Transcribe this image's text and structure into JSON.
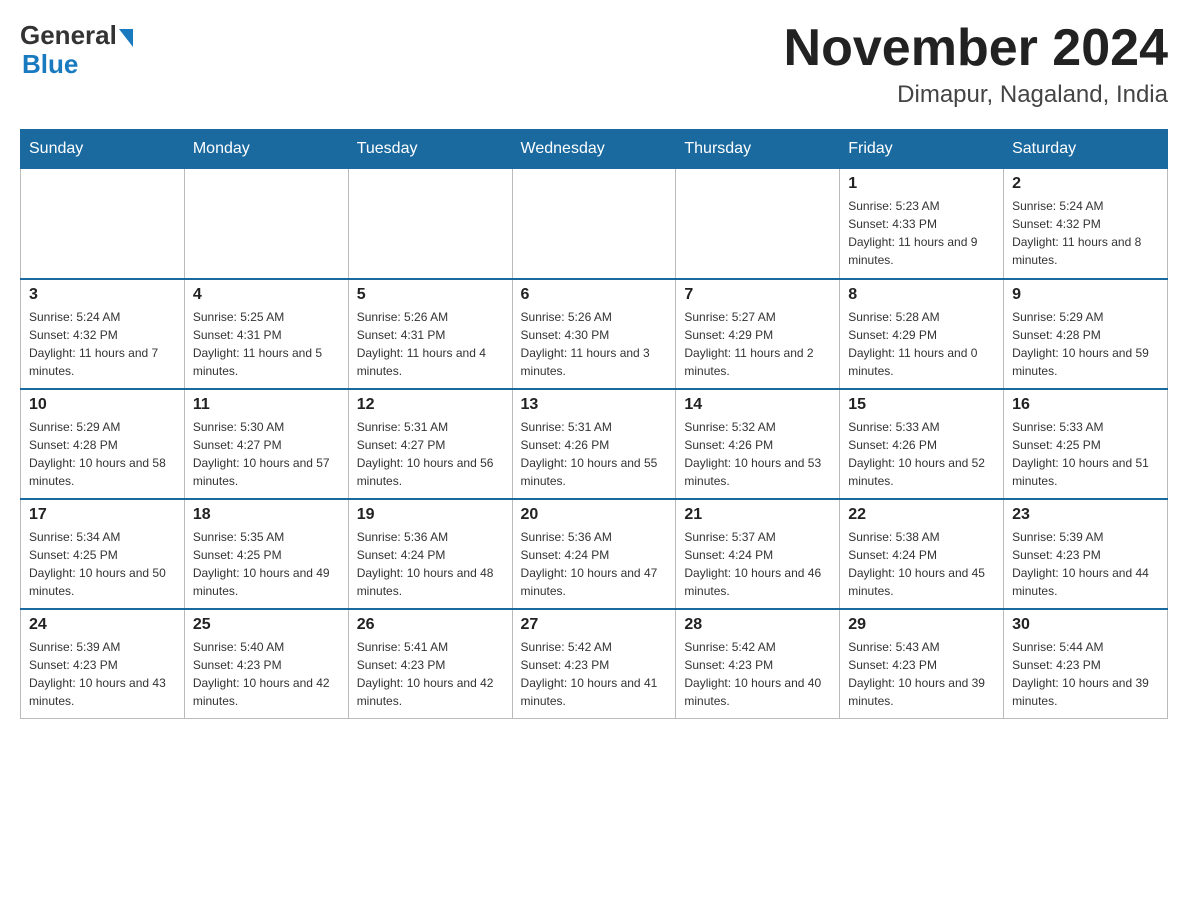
{
  "header": {
    "logo_general": "General",
    "logo_blue": "Blue",
    "month_title": "November 2024",
    "location": "Dimapur, Nagaland, India"
  },
  "days_of_week": [
    "Sunday",
    "Monday",
    "Tuesday",
    "Wednesday",
    "Thursday",
    "Friday",
    "Saturday"
  ],
  "weeks": [
    [
      {
        "day": "",
        "sunrise": "",
        "sunset": "",
        "daylight": ""
      },
      {
        "day": "",
        "sunrise": "",
        "sunset": "",
        "daylight": ""
      },
      {
        "day": "",
        "sunrise": "",
        "sunset": "",
        "daylight": ""
      },
      {
        "day": "",
        "sunrise": "",
        "sunset": "",
        "daylight": ""
      },
      {
        "day": "",
        "sunrise": "",
        "sunset": "",
        "daylight": ""
      },
      {
        "day": "1",
        "sunrise": "Sunrise: 5:23 AM",
        "sunset": "Sunset: 4:33 PM",
        "daylight": "Daylight: 11 hours and 9 minutes."
      },
      {
        "day": "2",
        "sunrise": "Sunrise: 5:24 AM",
        "sunset": "Sunset: 4:32 PM",
        "daylight": "Daylight: 11 hours and 8 minutes."
      }
    ],
    [
      {
        "day": "3",
        "sunrise": "Sunrise: 5:24 AM",
        "sunset": "Sunset: 4:32 PM",
        "daylight": "Daylight: 11 hours and 7 minutes."
      },
      {
        "day": "4",
        "sunrise": "Sunrise: 5:25 AM",
        "sunset": "Sunset: 4:31 PM",
        "daylight": "Daylight: 11 hours and 5 minutes."
      },
      {
        "day": "5",
        "sunrise": "Sunrise: 5:26 AM",
        "sunset": "Sunset: 4:31 PM",
        "daylight": "Daylight: 11 hours and 4 minutes."
      },
      {
        "day": "6",
        "sunrise": "Sunrise: 5:26 AM",
        "sunset": "Sunset: 4:30 PM",
        "daylight": "Daylight: 11 hours and 3 minutes."
      },
      {
        "day": "7",
        "sunrise": "Sunrise: 5:27 AM",
        "sunset": "Sunset: 4:29 PM",
        "daylight": "Daylight: 11 hours and 2 minutes."
      },
      {
        "day": "8",
        "sunrise": "Sunrise: 5:28 AM",
        "sunset": "Sunset: 4:29 PM",
        "daylight": "Daylight: 11 hours and 0 minutes."
      },
      {
        "day": "9",
        "sunrise": "Sunrise: 5:29 AM",
        "sunset": "Sunset: 4:28 PM",
        "daylight": "Daylight: 10 hours and 59 minutes."
      }
    ],
    [
      {
        "day": "10",
        "sunrise": "Sunrise: 5:29 AM",
        "sunset": "Sunset: 4:28 PM",
        "daylight": "Daylight: 10 hours and 58 minutes."
      },
      {
        "day": "11",
        "sunrise": "Sunrise: 5:30 AM",
        "sunset": "Sunset: 4:27 PM",
        "daylight": "Daylight: 10 hours and 57 minutes."
      },
      {
        "day": "12",
        "sunrise": "Sunrise: 5:31 AM",
        "sunset": "Sunset: 4:27 PM",
        "daylight": "Daylight: 10 hours and 56 minutes."
      },
      {
        "day": "13",
        "sunrise": "Sunrise: 5:31 AM",
        "sunset": "Sunset: 4:26 PM",
        "daylight": "Daylight: 10 hours and 55 minutes."
      },
      {
        "day": "14",
        "sunrise": "Sunrise: 5:32 AM",
        "sunset": "Sunset: 4:26 PM",
        "daylight": "Daylight: 10 hours and 53 minutes."
      },
      {
        "day": "15",
        "sunrise": "Sunrise: 5:33 AM",
        "sunset": "Sunset: 4:26 PM",
        "daylight": "Daylight: 10 hours and 52 minutes."
      },
      {
        "day": "16",
        "sunrise": "Sunrise: 5:33 AM",
        "sunset": "Sunset: 4:25 PM",
        "daylight": "Daylight: 10 hours and 51 minutes."
      }
    ],
    [
      {
        "day": "17",
        "sunrise": "Sunrise: 5:34 AM",
        "sunset": "Sunset: 4:25 PM",
        "daylight": "Daylight: 10 hours and 50 minutes."
      },
      {
        "day": "18",
        "sunrise": "Sunrise: 5:35 AM",
        "sunset": "Sunset: 4:25 PM",
        "daylight": "Daylight: 10 hours and 49 minutes."
      },
      {
        "day": "19",
        "sunrise": "Sunrise: 5:36 AM",
        "sunset": "Sunset: 4:24 PM",
        "daylight": "Daylight: 10 hours and 48 minutes."
      },
      {
        "day": "20",
        "sunrise": "Sunrise: 5:36 AM",
        "sunset": "Sunset: 4:24 PM",
        "daylight": "Daylight: 10 hours and 47 minutes."
      },
      {
        "day": "21",
        "sunrise": "Sunrise: 5:37 AM",
        "sunset": "Sunset: 4:24 PM",
        "daylight": "Daylight: 10 hours and 46 minutes."
      },
      {
        "day": "22",
        "sunrise": "Sunrise: 5:38 AM",
        "sunset": "Sunset: 4:24 PM",
        "daylight": "Daylight: 10 hours and 45 minutes."
      },
      {
        "day": "23",
        "sunrise": "Sunrise: 5:39 AM",
        "sunset": "Sunset: 4:23 PM",
        "daylight": "Daylight: 10 hours and 44 minutes."
      }
    ],
    [
      {
        "day": "24",
        "sunrise": "Sunrise: 5:39 AM",
        "sunset": "Sunset: 4:23 PM",
        "daylight": "Daylight: 10 hours and 43 minutes."
      },
      {
        "day": "25",
        "sunrise": "Sunrise: 5:40 AM",
        "sunset": "Sunset: 4:23 PM",
        "daylight": "Daylight: 10 hours and 42 minutes."
      },
      {
        "day": "26",
        "sunrise": "Sunrise: 5:41 AM",
        "sunset": "Sunset: 4:23 PM",
        "daylight": "Daylight: 10 hours and 42 minutes."
      },
      {
        "day": "27",
        "sunrise": "Sunrise: 5:42 AM",
        "sunset": "Sunset: 4:23 PM",
        "daylight": "Daylight: 10 hours and 41 minutes."
      },
      {
        "day": "28",
        "sunrise": "Sunrise: 5:42 AM",
        "sunset": "Sunset: 4:23 PM",
        "daylight": "Daylight: 10 hours and 40 minutes."
      },
      {
        "day": "29",
        "sunrise": "Sunrise: 5:43 AM",
        "sunset": "Sunset: 4:23 PM",
        "daylight": "Daylight: 10 hours and 39 minutes."
      },
      {
        "day": "30",
        "sunrise": "Sunrise: 5:44 AM",
        "sunset": "Sunset: 4:23 PM",
        "daylight": "Daylight: 10 hours and 39 minutes."
      }
    ]
  ]
}
